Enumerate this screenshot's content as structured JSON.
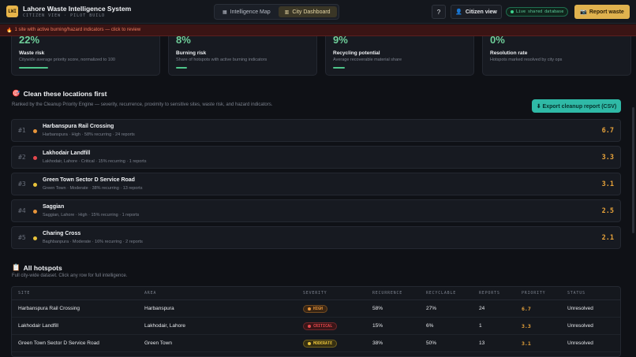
{
  "app": {
    "logo_text": "LWI",
    "title": "Lahore Waste Intelligence System",
    "subtitle": "CITIZEN VIEW · PILOT BUILD"
  },
  "nav": {
    "tabs": [
      {
        "label": "Intelligence Map",
        "icon": "map-icon"
      },
      {
        "label": "City Dashboard",
        "icon": "chart-icon",
        "active": true
      }
    ],
    "help_label": "?",
    "citizen_view_label": "Citizen view",
    "live_badge": "Live shared database",
    "report_label": "Report waste"
  },
  "alert": {
    "icon": "🔥",
    "text": "1 site with active burning/hazard indicators — click to review"
  },
  "metrics": [
    {
      "value": "22%",
      "label": "Waste risk",
      "desc": "Citywide average priority score, normalized to 100",
      "level": 0.22
    },
    {
      "value": "8%",
      "label": "Burning risk",
      "desc": "Share of hotspots with active burning indicators",
      "level": 0.08
    },
    {
      "value": "9%",
      "label": "Recycling potential",
      "desc": "Average recoverable material share",
      "level": 0.09
    },
    {
      "value": "0%",
      "label": "Resolution rate",
      "desc": "Hotspots marked resolved by city ops",
      "level": 0.0
    }
  ],
  "priority": {
    "icon": "🎯",
    "title": "Clean these locations first",
    "subtitle": "Ranked by the Cleanup Priority Engine — severity, recurrence, proximity to sensitive sites, waste risk, and hazard indicators.",
    "export_label": "⬇ Export cleanup report (CSV)",
    "items": [
      {
        "rank": "#1",
        "name": "Harbanspura Rail Crossing",
        "meta": "Harbanspura · High · 58% recurring · 24 reports",
        "score": "6.7",
        "color": "#e8953a"
      },
      {
        "rank": "#2",
        "name": "Lakhodair Landfill",
        "meta": "Lakhodair, Lahore · Critical · 15% recurring · 1 reports",
        "score": "3.3",
        "color": "#e5484d"
      },
      {
        "rank": "#3",
        "name": "Green Town Sector D Service Road",
        "meta": "Green Town · Moderate · 38% recurring · 13 reports",
        "score": "3.1",
        "color": "#e8c23a"
      },
      {
        "rank": "#4",
        "name": "Saggian",
        "meta": "Saggian, Lahore · High · 15% recurring · 1 reports",
        "score": "2.5",
        "color": "#e8953a"
      },
      {
        "rank": "#5",
        "name": "Charing Cross",
        "meta": "Baghbanpura · Moderate · 16% recurring · 2 reports",
        "score": "2.1",
        "color": "#e8c23a"
      }
    ]
  },
  "hotspots": {
    "icon": "📋",
    "title": "All hotspots",
    "subtitle": "Full city-wide dataset. Click any row for full intelligence.",
    "columns": [
      "SITE",
      "AREA",
      "SEVERITY",
      "RECURRENCE",
      "RECYCLABLE",
      "REPORTS",
      "PRIORITY",
      "STATUS"
    ],
    "rows": [
      {
        "site": "Harbanspura Rail Crossing",
        "area": "Harbanspura",
        "severity": "HIGH",
        "sev_color": "#e8953a",
        "sev_bg": "#3a2614",
        "recurrence": "58%",
        "recyclable": "27%",
        "reports": "24",
        "priority": "6.7",
        "status": "Unresolved"
      },
      {
        "site": "Lakhodair Landfill",
        "area": "Lakhodair, Lahore",
        "severity": "CRITICAL",
        "sev_color": "#e5484d",
        "sev_bg": "#3a1618",
        "recurrence": "15%",
        "recyclable": "6%",
        "reports": "1",
        "priority": "3.3",
        "status": "Unresolved"
      },
      {
        "site": "Green Town Sector D Service Road",
        "area": "Green Town",
        "severity": "MODERATE",
        "sev_color": "#e8c23a",
        "sev_bg": "#362f12",
        "recurrence": "38%",
        "recyclable": "50%",
        "reports": "13",
        "priority": "3.1",
        "status": "Unresolved"
      }
    ]
  }
}
